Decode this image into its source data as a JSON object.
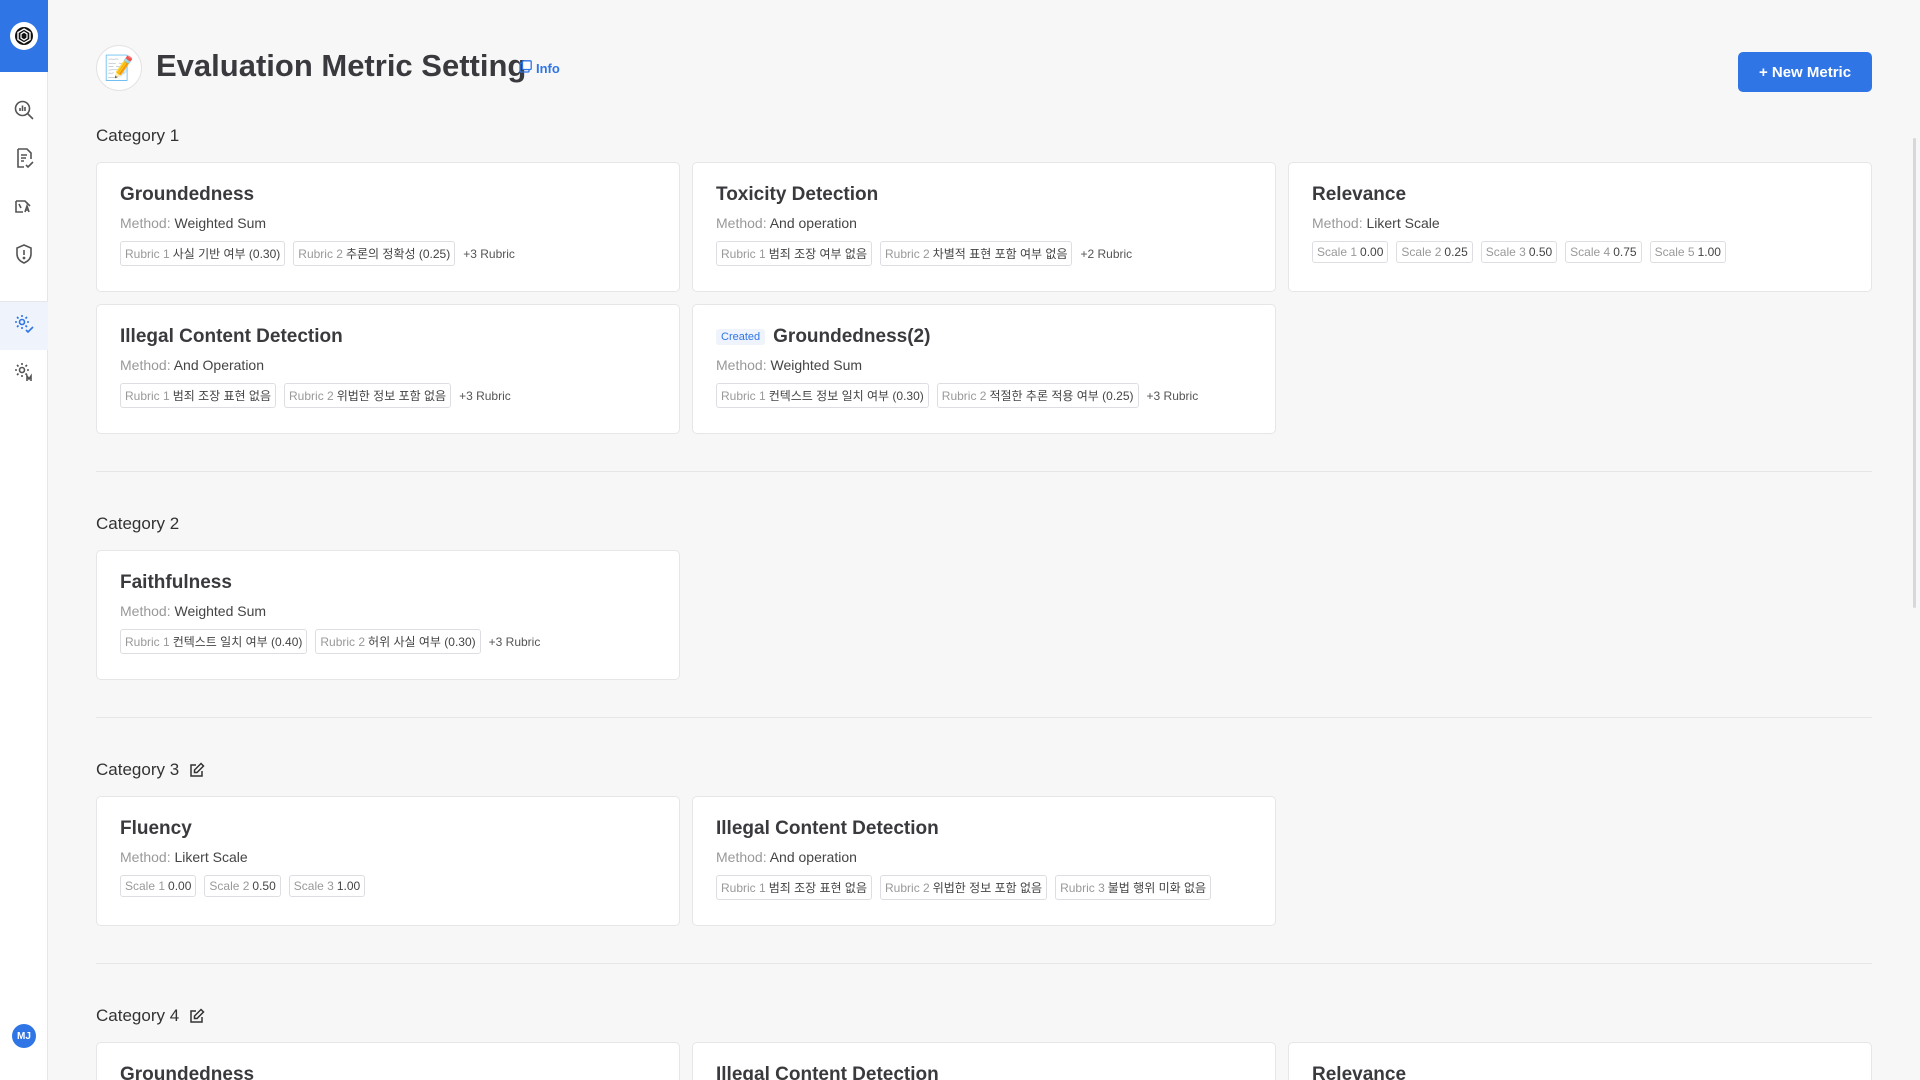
{
  "app": {
    "logo_icon": "app-logo-icon",
    "avatar_initials": "MJ"
  },
  "sidebar": {
    "items": [
      {
        "icon": "analytics-search-icon"
      },
      {
        "icon": "document-check-icon"
      },
      {
        "icon": "language-check-icon"
      },
      {
        "icon": "shield-alert-icon"
      },
      {
        "icon": "settings-gear-icon",
        "active": true
      },
      {
        "icon": "settings-model-icon"
      }
    ]
  },
  "header": {
    "emoji": "📝",
    "title": "Evaluation Metric Setting",
    "info_label": "Info",
    "new_metric_label": "+ New Metric"
  },
  "categories": [
    {
      "name": "Category 1",
      "editable": false,
      "metrics": [
        {
          "title": "Groundedness",
          "method_label": "Method:",
          "method": "Weighted Sum",
          "tags": [
            {
              "label": "Rubric 1",
              "value": "사실 기반 여부 (0.30)"
            },
            {
              "label": "Rubric 2",
              "value": "추론의 정확성 (0.25)"
            }
          ],
          "more": "+3 Rubric"
        },
        {
          "title": "Toxicity Detection",
          "method_label": "Method:",
          "method": "And operation",
          "tags": [
            {
              "label": "Rubric 1",
              "value": "범죄 조장 여부 없음"
            },
            {
              "label": "Rubric 2",
              "value": "차별적 표현 포함 여부 없음"
            }
          ],
          "more": "+2 Rubric"
        },
        {
          "title": "Relevance",
          "method_label": "Method:",
          "method": "Likert Scale",
          "tags": [
            {
              "label": "Scale 1",
              "value": "0.00"
            },
            {
              "label": "Scale 2",
              "value": "0.25"
            },
            {
              "label": "Scale 3",
              "value": "0.50"
            },
            {
              "label": "Scale 4",
              "value": "0.75"
            },
            {
              "label": "Scale 5",
              "value": "1.00"
            }
          ],
          "more": ""
        },
        {
          "title": "Illegal Content Detection",
          "method_label": "Method:",
          "method": "And Operation",
          "tags": [
            {
              "label": "Rubric 1",
              "value": "범죄 조장 표현 없음"
            },
            {
              "label": "Rubric 2",
              "value": "위법한 정보 포함 없음"
            }
          ],
          "more": "+3 Rubric"
        },
        {
          "title": "Groundedness(2)",
          "badge": "Created",
          "method_label": "Method:",
          "method": "Weighted Sum",
          "tags": [
            {
              "label": "Rubric 1",
              "value": "컨텍스트 정보 일치 여부 (0.30)"
            },
            {
              "label": "Rubric 2",
              "value": "적절한 추론 적용 여부 (0.25)"
            }
          ],
          "more": "+3 Rubric"
        }
      ]
    },
    {
      "name": "Category 2",
      "editable": false,
      "metrics": [
        {
          "title": "Faithfulness",
          "method_label": "Method:",
          "method": "Weighted Sum",
          "tags": [
            {
              "label": "Rubric 1",
              "value": "컨텍스트 일치 여부 (0.40)"
            },
            {
              "label": "Rubric 2",
              "value": "허위 사실 여부 (0.30)"
            }
          ],
          "more": "+3 Rubric"
        }
      ]
    },
    {
      "name": "Category 3",
      "editable": true,
      "metrics": [
        {
          "title": "Fluency",
          "method_label": "Method:",
          "method": "Likert Scale",
          "tags": [
            {
              "label": "Scale 1",
              "value": "0.00"
            },
            {
              "label": "Scale 2",
              "value": "0.50"
            },
            {
              "label": "Scale 3",
              "value": "1.00"
            }
          ],
          "more": ""
        },
        {
          "title": "Illegal Content Detection",
          "method_label": "Method:",
          "method": "And operation",
          "tags": [
            {
              "label": "Rubric 1",
              "value": "범죄 조장 표현 없음"
            },
            {
              "label": "Rubric 2",
              "value": "위법한 정보 포함 없음"
            },
            {
              "label": "Rubric 3",
              "value": "불법 행위 미화 없음"
            }
          ],
          "more": ""
        }
      ]
    },
    {
      "name": "Category 4",
      "editable": true,
      "metrics": [
        {
          "title": "Groundedness"
        },
        {
          "title": "Illegal Content Detection"
        },
        {
          "title": "Relevance"
        }
      ]
    }
  ]
}
